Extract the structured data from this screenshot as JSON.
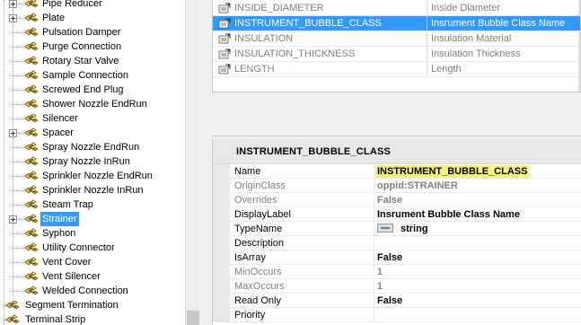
{
  "tree": {
    "items": [
      {
        "label": "Pipe Reducer",
        "expandable": true,
        "selected": false,
        "level": 1
      },
      {
        "label": "Plate",
        "expandable": true,
        "selected": false,
        "level": 1
      },
      {
        "label": "Pulsation Damper",
        "expandable": false,
        "selected": false,
        "level": 1
      },
      {
        "label": "Purge Connection",
        "expandable": false,
        "selected": false,
        "level": 1
      },
      {
        "label": "Rotary Star Valve",
        "expandable": false,
        "selected": false,
        "level": 1
      },
      {
        "label": "Sample Connection",
        "expandable": false,
        "selected": false,
        "level": 1
      },
      {
        "label": "Screwed End Plug",
        "expandable": false,
        "selected": false,
        "level": 1
      },
      {
        "label": "Shower Nozzle EndRun",
        "expandable": false,
        "selected": false,
        "level": 1
      },
      {
        "label": "Silencer",
        "expandable": false,
        "selected": false,
        "level": 1
      },
      {
        "label": "Spacer",
        "expandable": true,
        "selected": false,
        "level": 1
      },
      {
        "label": "Spray Nozzle EndRun",
        "expandable": false,
        "selected": false,
        "level": 1
      },
      {
        "label": "Spray Nozzle InRun",
        "expandable": false,
        "selected": false,
        "level": 1
      },
      {
        "label": "Sprinkler Nozzle EndRun",
        "expandable": false,
        "selected": false,
        "level": 1
      },
      {
        "label": "Sprinkler Nozzle InRun",
        "expandable": false,
        "selected": false,
        "level": 1
      },
      {
        "label": "Steam Trap",
        "expandable": false,
        "selected": false,
        "level": 1
      },
      {
        "label": "Strainer",
        "expandable": true,
        "selected": true,
        "level": 1
      },
      {
        "label": "Syphon",
        "expandable": false,
        "selected": false,
        "level": 1
      },
      {
        "label": "Utility Connector",
        "expandable": false,
        "selected": false,
        "level": 1
      },
      {
        "label": "Vent Cover",
        "expandable": false,
        "selected": false,
        "level": 1
      },
      {
        "label": "Vent Silencer",
        "expandable": false,
        "selected": false,
        "level": 1
      },
      {
        "label": "Welded Connection",
        "expandable": false,
        "selected": false,
        "level": 1
      },
      {
        "label": "Segment Termination",
        "expandable": false,
        "selected": false,
        "level": 0
      },
      {
        "label": "Terminal Strip",
        "expandable": false,
        "selected": false,
        "level": 0
      }
    ]
  },
  "attributes": {
    "rows": [
      {
        "name": "INSIDE_DIAMETER",
        "description": "Inside Diameter",
        "selected": false
      },
      {
        "name": "INSTRUMENT_BUBBLE_CLASS",
        "description": "Insrument Bubble Class Name",
        "selected": true
      },
      {
        "name": "INSULATION",
        "description": "Insulation Material",
        "selected": false
      },
      {
        "name": "INSULATION_THICKNESS",
        "description": "Insulation Thickness",
        "selected": false
      },
      {
        "name": "LENGTH",
        "description": "Length",
        "selected": false
      }
    ]
  },
  "detail": {
    "title": "INSTRUMENT_BUBBLE_CLASS",
    "properties": [
      {
        "name": "Name",
        "value": "INSTRUMENT_BUBBLE_CLASS",
        "dim": false,
        "highlight": true
      },
      {
        "name": "OriginClass",
        "value": "oppid:STRAINER",
        "dim": true,
        "highlight": false
      },
      {
        "name": "Overrides",
        "value": "False",
        "dim": true,
        "highlight": false
      },
      {
        "name": "DisplayLabel",
        "value": "Insrument Bubble Class Name",
        "dim": false,
        "highlight": false
      },
      {
        "name": "TypeName",
        "value": "string",
        "dim": false,
        "highlight": false,
        "icon": "type-icon"
      },
      {
        "name": "Description",
        "value": "",
        "dim": false,
        "highlight": false
      },
      {
        "name": "IsArray",
        "value": "False",
        "dim": false,
        "highlight": false
      },
      {
        "name": "MinOccurs",
        "value": "1",
        "dim": true,
        "highlight": false
      },
      {
        "name": "MaxOccurs",
        "value": "1",
        "dim": true,
        "highlight": false
      },
      {
        "name": "Read Only",
        "value": "False",
        "dim": false,
        "highlight": false
      },
      {
        "name": "Priority",
        "value": "",
        "dim": false,
        "highlight": false
      }
    ]
  },
  "colors": {
    "selection": "#3399ff",
    "highlight": "#f6f37a",
    "dim_text": "#808080"
  }
}
